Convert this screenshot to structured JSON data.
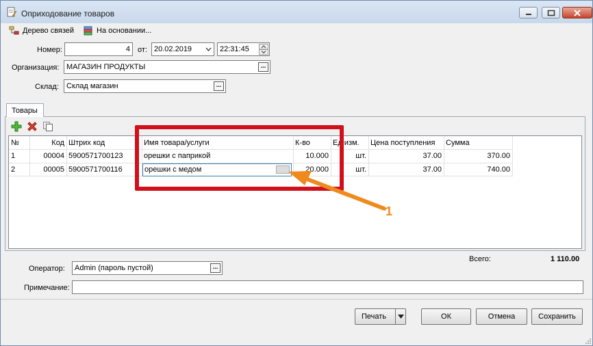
{
  "window": {
    "title": "Оприходование товаров",
    "accent": "#6d8ab0"
  },
  "toolbar": {
    "tree_label": "Дерево связей",
    "based_on_label": "На основании..."
  },
  "header": {
    "number_label": "Номер:",
    "number_value": "4",
    "from_label": "от:",
    "date_value": "20.02.2019",
    "time_value": "22:31:45",
    "org_label": "Организация:",
    "org_value": "МАГАЗИН ПРОДУКТЫ",
    "warehouse_label": "Склад:",
    "warehouse_value": "Склад магазин"
  },
  "tabs": [
    {
      "label": "Товары"
    }
  ],
  "table": {
    "columns": [
      "№",
      "Код",
      "Штрих код",
      "Имя товара/услуги",
      "К-во",
      "Ед.изм.",
      "Цена поступления",
      "Сумма"
    ],
    "rows": [
      [
        "1",
        "00004",
        "5900571700123",
        "орешки с паприкой",
        "10.000",
        "шт.",
        "37.00",
        "370.00"
      ],
      [
        "2",
        "00005",
        "5900571700116",
        "орешки с медом",
        "20.000",
        "шт.",
        "37.00",
        "740.00"
      ]
    ]
  },
  "annotation": {
    "number": "1",
    "highlight_color": "#d0101a",
    "arrow_color": "#f08a1c"
  },
  "footer": {
    "total_label": "Всего:",
    "total_value": "1 110.00",
    "operator_label": "Оператор:",
    "operator_value": "Admin (пароль пустой)",
    "note_label": "Примечание:",
    "note_value": ""
  },
  "buttons": {
    "print": "Печать",
    "ok": "ОК",
    "cancel": "Отмена",
    "save": "Сохранить"
  }
}
